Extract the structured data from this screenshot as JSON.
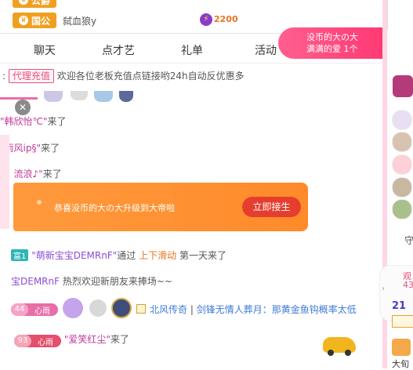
{
  "ranking": [
    {
      "tag": "公爵",
      "name": "",
      "value": ""
    },
    {
      "tag": "国公",
      "name": "弑血狼y",
      "value": "2200"
    }
  ],
  "tabs": [
    "聊天",
    "点才艺",
    "礼单",
    "活动"
  ],
  "promo": {
    "line1": "没币的大の大",
    "line2": "满满的爱 1个"
  },
  "notice": {
    "tag": "代理充值",
    "text": "欢迎各位老板充值点链接哟24h自动反优惠多"
  },
  "messages": [
    {
      "user": "韩欣怡℃",
      "action": "来了"
    },
    {
      "user": "雨风ip§",
      "action": "来了"
    },
    {
      "user": "、流浪♪",
      "action": "来了"
    }
  ],
  "banner": {
    "text": "恭喜没币的大の大升级到大帝啦",
    "button": "立即接生"
  },
  "follow_msg": {
    "tag": "富1",
    "user": "萌新宝宝DEMRnF",
    "mid": "通过",
    "source": "上下滑动",
    "rest": "第一天来了"
  },
  "welcome_msg": {
    "user": "宝DEMRnF",
    "text": "热烈欢迎新朋友来捧场~~"
  },
  "chat_msg": {
    "level": "44",
    "level_name": "心雨",
    "guild": "北风传奇",
    "sep": "|",
    "content": "剑锋无情人葬月：那黄金鱼钩概率太低"
  },
  "last_msg": {
    "level": "93",
    "level_name": "心雨",
    "user": "爱笑红尘",
    "action": "来了"
  },
  "right_panel": {
    "watch_label": "观",
    "watch_count": "43",
    "rank_num": "21",
    "guard_label": "守",
    "bottom_label": "大旬"
  }
}
